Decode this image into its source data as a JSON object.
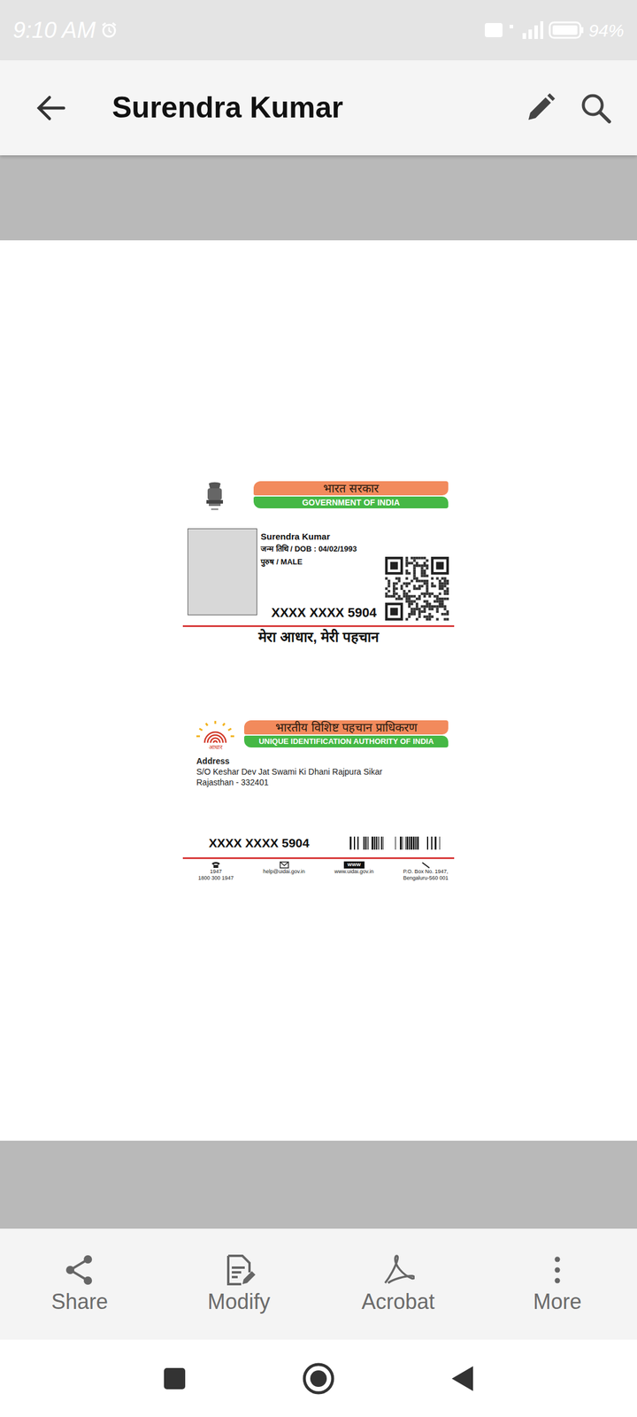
{
  "status_bar": {
    "time": "9:10 AM",
    "battery": "94%"
  },
  "toolbar": {
    "title": "Surendra Kumar"
  },
  "document": {
    "front": {
      "header_hi": "भारत सरकार",
      "header_en": "GOVERNMENT OF INDIA",
      "name": "Surendra Kumar",
      "dob": "जन्म तिथि / DOB : 04/02/1993",
      "gender": "पुरुष / MALE",
      "number": "XXXX XXXX 5904",
      "slogan": "मेरा आधार, मेरी पहचान"
    },
    "back": {
      "logo_text": "आधार",
      "header_hi": "भारतीय विशिष्ट पहचान प्राधिकरण",
      "header_en": "UNIQUE IDENTIFICATION AUTHORITY OF INDIA",
      "address_label": "Address",
      "address_lines": [
        "S/O  Keshar Dev Jat Swami Ki Dhani Rajpura Sikar",
        "Rajasthan - 332401"
      ],
      "number": "XXXX XXXX 5904",
      "footer": [
        {
          "kind": "phone",
          "lines": [
            "1947",
            "1800 300 1947"
          ]
        },
        {
          "kind": "email",
          "lines": [
            "help@uidai.gov.in"
          ]
        },
        {
          "kind": "web",
          "badge": "WWW",
          "lines": [
            "www.uidai.gov.in"
          ]
        },
        {
          "kind": "post",
          "lines": [
            "P.O. Box No. 1947,",
            "Bengaluru-560 001"
          ]
        }
      ]
    }
  },
  "bottom_bar": [
    {
      "label": "Share",
      "kind": "share"
    },
    {
      "label": "Modify",
      "kind": "modify"
    },
    {
      "label": "Acrobat",
      "kind": "acrobat"
    },
    {
      "label": "More",
      "kind": "more"
    }
  ]
}
